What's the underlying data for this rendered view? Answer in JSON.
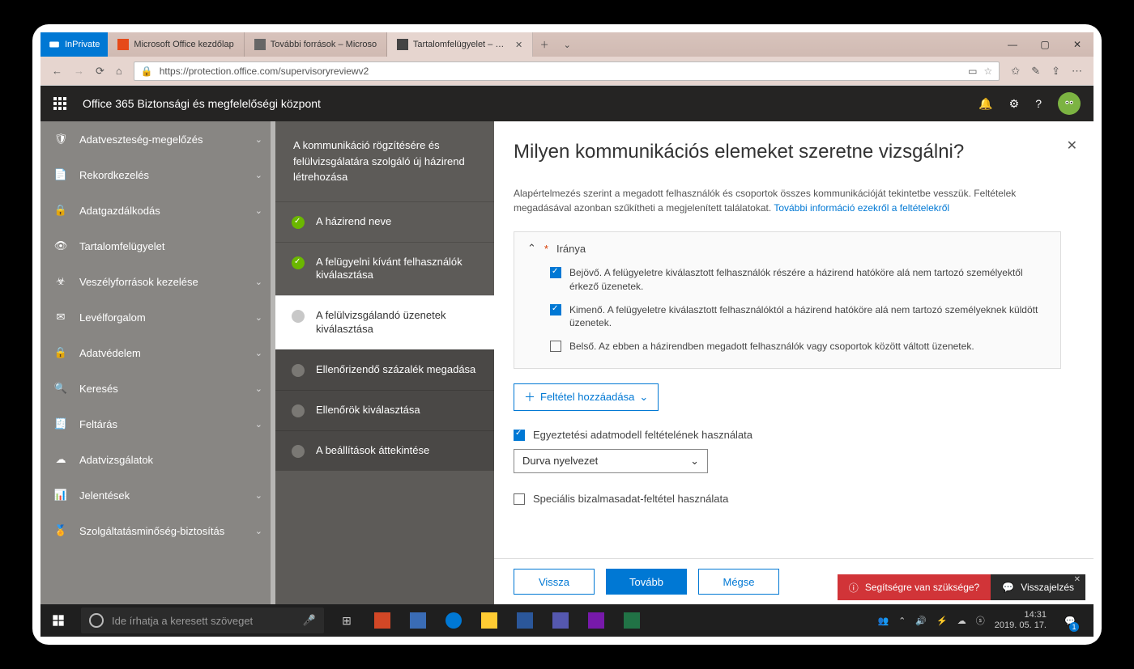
{
  "browser": {
    "inprivate": "InPrivate",
    "tabs": [
      {
        "label": "Microsoft Office kezdőlap"
      },
      {
        "label": "További források – Microso"
      },
      {
        "label": "Tartalomfelügyelet – Biz"
      }
    ],
    "url": "https://protection.office.com/supervisoryreviewv2"
  },
  "suite": {
    "title": "Office 365 Biztonsági és megfelelőségi központ"
  },
  "leftnav": {
    "items": [
      {
        "label": "Adatveszteség-megelőzés",
        "chev": true
      },
      {
        "label": "Rekordkezelés",
        "chev": true
      },
      {
        "label": "Adatgazdálkodás",
        "chev": true
      },
      {
        "label": "Tartalomfelügyelet",
        "chev": false
      },
      {
        "label": "Veszélyforrások kezelése",
        "chev": true
      },
      {
        "label": "Levélforgalom",
        "chev": true
      },
      {
        "label": "Adatvédelem",
        "chev": true
      },
      {
        "label": "Keresés",
        "chev": true
      },
      {
        "label": "Feltárás",
        "chev": true
      },
      {
        "label": "Adatvizsgálatok",
        "chev": false
      },
      {
        "label": "Jelentések",
        "chev": true
      },
      {
        "label": "Szolgáltatásminőség-biztosítás",
        "chev": true
      }
    ]
  },
  "wizard": {
    "header": "A kommunikáció rögzítésére és felülvizsgálatára szolgáló új házirend létrehozása",
    "steps": [
      {
        "label": "A házirend neve",
        "state": "done"
      },
      {
        "label": "A felügyelni kívánt felhasználók kiválasztása",
        "state": "done"
      },
      {
        "label": "A felülvizsgálandó üzenetek kiválasztása",
        "state": "current"
      },
      {
        "label": "Ellenőrizendő százalék megadása",
        "state": "dark"
      },
      {
        "label": "Ellenőrök kiválasztása",
        "state": "dark"
      },
      {
        "label": "A beállítások áttekintése",
        "state": "dark"
      }
    ]
  },
  "page": {
    "title": "Milyen kommunikációs elemeket szeretne vizsgálni?",
    "desc": "Alapértelmezés szerint a megadott felhasználók és csoportok összes kommunikációját tekintetbe vesszük. Feltételek megadásával azonban szűkítheti a megjelenített találatokat. ",
    "desc_link": "További információ ezekről a feltételekről",
    "section_label": "Iránya",
    "direction": [
      {
        "checked": true,
        "text": "Bejövő. A felügyeletre kiválasztott felhasználók részére a házirend hatóköre alá nem tartozó személyektől érkező üzenetek."
      },
      {
        "checked": true,
        "text": "Kimenő. A felügyeletre kiválasztott felhasználóktól a házirend hatóköre alá nem tartozó személyeknek küldött üzenetek."
      },
      {
        "checked": false,
        "text": "Belső. Az ebben a házirendben megadott felhasználók vagy csoportok között váltott üzenetek."
      }
    ],
    "add_condition": "Feltétel hozzáadása",
    "use_model_label": "Egyeztetési adatmodell feltételének használata",
    "dropdown_value": "Durva nyelvezet",
    "special_label": "Speciális bizalmasadat-feltétel használata",
    "back": "Vissza",
    "next": "Tovább",
    "cancel": "Mégse"
  },
  "help": {
    "need": "Segítségre van szüksége?",
    "feedback": "Visszajelzés"
  },
  "taskbar": {
    "search_ph": "Ide írhatja a keresett szöveget",
    "time": "14:31",
    "date": "2019. 05. 17.",
    "notif": "1"
  }
}
